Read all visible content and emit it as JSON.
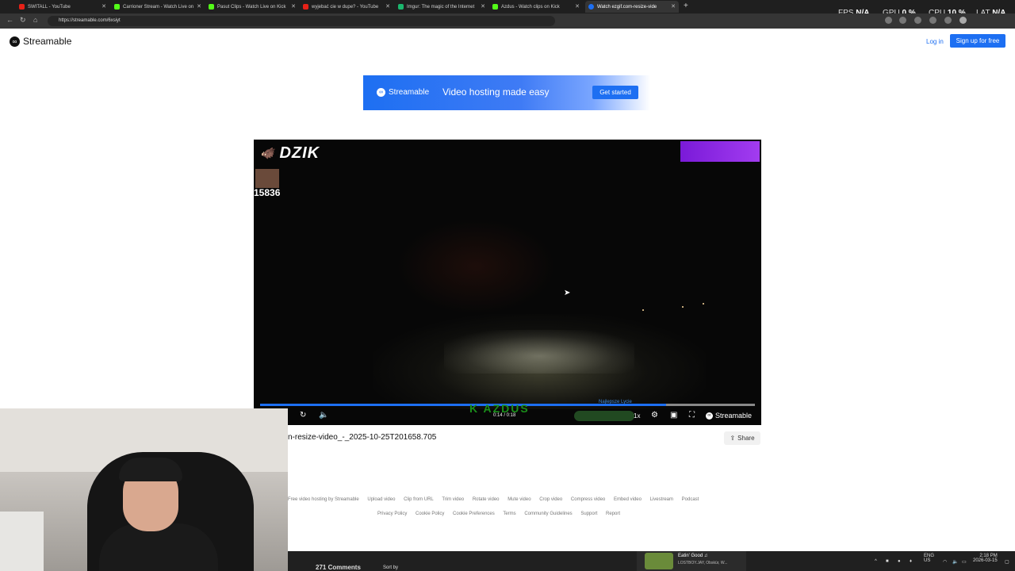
{
  "browser": {
    "tabs": [
      {
        "title": "SWITALL - YouTube",
        "color": "#e62117"
      },
      {
        "title": "Carrioner Stream - Watch Live on",
        "color": "#53fc18"
      },
      {
        "title": "Pasut Clips - Watch Live on Kick",
        "color": "#53fc18"
      },
      {
        "title": "wyjebać cie w dupe? - YouTube",
        "color": "#e62117"
      },
      {
        "title": "Imgur: The magic of the Internet",
        "color": "#1bb76e"
      },
      {
        "title": "Azdus - Watch clips on Kick",
        "color": "#53fc18"
      },
      {
        "title": "Watch ezgif.com-resize-vide",
        "color": "#1d6ff2"
      }
    ],
    "url": "https://streamable.com/6xsiyt",
    "hud": {
      "fps_label": "FPS",
      "fps_value": "N/A",
      "gpu_label": "GPU",
      "gpu_value": "0 %",
      "cpu_label": "CPU",
      "cpu_value": "10 %",
      "lat_label": "LAT",
      "lat_value": "N/A"
    }
  },
  "header": {
    "brand": "Streamable",
    "login": "Log in",
    "signup": "Sign up for free"
  },
  "banner": {
    "brand": "Streamable",
    "text": "Video hosting made easy",
    "cta": "Get started"
  },
  "video": {
    "overlay_brand": "DZIK",
    "overlay_count": "15836",
    "kick_overlay": "K AZDUS",
    "overlay_label": "Najlepsze Lycie",
    "time": "0:14 / 0:18",
    "speed": "1x",
    "player_brand": "Streamable",
    "progress": 0.82
  },
  "title": "n-resize-video_-_2025-10-25T201658.705",
  "share": "Share",
  "footer": {
    "links1": [
      "Free video hosting by Streamable",
      "Upload video",
      "Clip from URL",
      "Trim video",
      "Rotate video",
      "Mute video",
      "Crop video",
      "Compress video",
      "Embed video",
      "Livestream",
      "Podcast"
    ],
    "links2": [
      "Privacy Policy",
      "Cookie Policy",
      "Cookie Preferences",
      "Terms",
      "Community Guidelines",
      "Support",
      "Report"
    ]
  },
  "taskbar": {
    "comments": "271 Comments",
    "sort": "Sort by",
    "media_title": "Eatin' Good ♫",
    "media_sub": "LOSTBOY.JAY, Obskür, W...",
    "lang1": "ENG",
    "lang2": "US",
    "time": "2:18 PM",
    "date": "2026-03-15"
  }
}
